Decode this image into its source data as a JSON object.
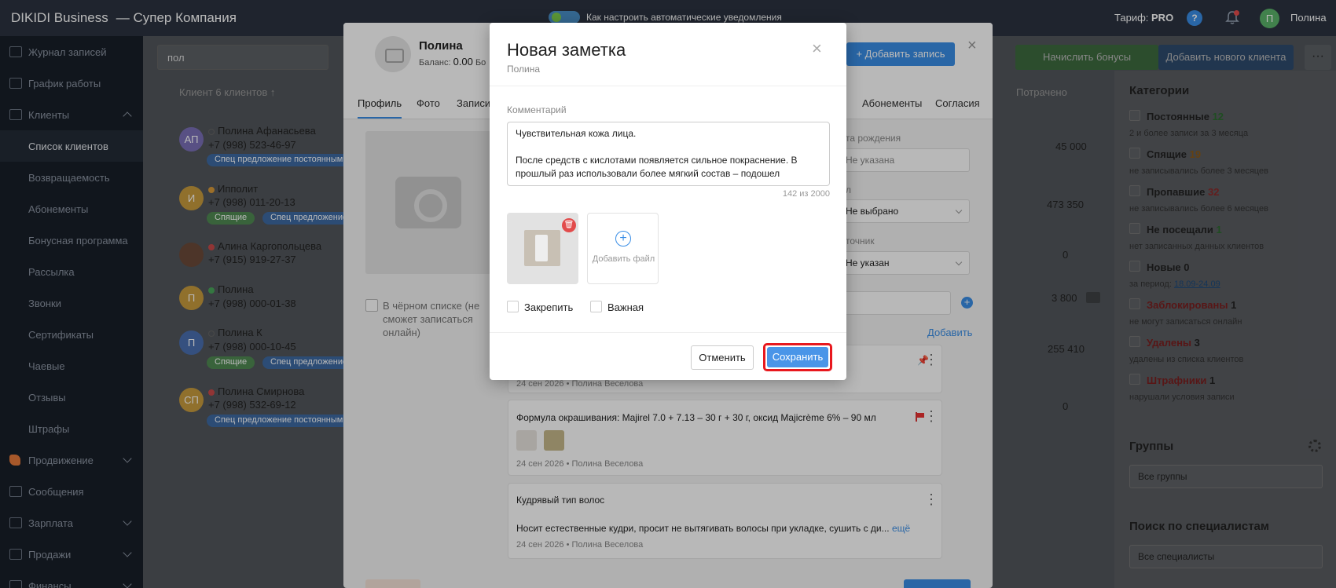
{
  "topbar": {
    "brand": "DIKIDI Business",
    "company": "— Супер Компания",
    "notice": "Как настроить автоматические уведомления",
    "tariff_label": "Тариф:",
    "tariff_value": "PRO",
    "help": "?",
    "user_initial": "П",
    "user_name": "Полина"
  },
  "sidebar": {
    "items": [
      {
        "label": "Журнал записей"
      },
      {
        "label": "График работы"
      },
      {
        "label": "Клиенты"
      },
      {
        "label": "Список клиентов"
      },
      {
        "label": "Возвращаемость"
      },
      {
        "label": "Абонементы"
      },
      {
        "label": "Бонусная программа"
      },
      {
        "label": "Рассылка"
      },
      {
        "label": "Звонки"
      },
      {
        "label": "Сертификаты"
      },
      {
        "label": "Чаевые"
      },
      {
        "label": "Отзывы"
      },
      {
        "label": "Штрафы"
      },
      {
        "label": "Продвижение"
      },
      {
        "label": "Сообщения"
      },
      {
        "label": "Зарплата"
      },
      {
        "label": "Продажи"
      },
      {
        "label": "Финансы"
      }
    ]
  },
  "clients": {
    "search_value": "пол",
    "header": "Клиент 6 клиентов ↑",
    "spent_header": "Потрачено",
    "buttons": {
      "bonus": "Начислить бонусы",
      "add_client": "Добавить нового клиента",
      "more": "···"
    },
    "rows": [
      {
        "initials": "АП",
        "name": "Полина Афанасьева",
        "phone": "+7 (998) 523-46-97",
        "tag1": "Спец предложение постоянным",
        "spent": "45 000"
      },
      {
        "initials": "И",
        "name": "Ипполит",
        "phone": "+7 (998) 011-20-13",
        "tag1": "Спящие",
        "tag2": "Спец предложение",
        "spent": "473 350"
      },
      {
        "initials": "",
        "name": "Алина Каргопольцева",
        "phone": "+7 (915) 919-27-37",
        "spent": "0"
      },
      {
        "initials": "П",
        "name": "Полина",
        "phone": "+7 (998) 000-01-38",
        "spent": "3 800"
      },
      {
        "initials": "П",
        "name": "Полина К",
        "phone": "+7 (998) 000-10-45",
        "tag1": "Спящие",
        "tag2": "Спец предложение",
        "spent": "255 410"
      },
      {
        "initials": "СП",
        "name": "Полина Смирнова",
        "phone": "+7 (998) 532-69-12",
        "tag1": "Спец предложение постоянным",
        "spent": "0"
      }
    ]
  },
  "categories": {
    "title": "Категории",
    "items": [
      {
        "name": "Постоянные",
        "count": "12",
        "desc": "2 и более записи за 3 месяца"
      },
      {
        "name": "Спящие",
        "count": "19",
        "desc": "не записывались более 3 месяцев"
      },
      {
        "name": "Пропавшие",
        "count": "32",
        "desc": "не записывались более 6 месяцев"
      },
      {
        "name": "Не посещали",
        "count": "1",
        "desc": "нет записанных данных клиентов"
      },
      {
        "name": "Новые",
        "count": "0",
        "desc": "за период:",
        "desc_link": "18.09-24.09"
      },
      {
        "name": "Заблокированы",
        "count": "1",
        "desc": "не могут записаться онлайн"
      },
      {
        "name": "Удалены",
        "count": "3",
        "desc": "удалены из списка клиентов"
      },
      {
        "name": "Штрафники",
        "count": "1",
        "desc": "нарушали условия записи"
      }
    ],
    "groups_title": "Группы",
    "groups_value": "Все группы",
    "specialists_title": "Поиск по специалистам",
    "specialists_value": "Все специалисты"
  },
  "client_card": {
    "name": "Полина",
    "balance_label": "Баланс:",
    "balance_value": "0.00",
    "balance_tail": "Бо",
    "add_record": "+ Добавить запись",
    "close": "×",
    "tabs": [
      "Профиль",
      "Фото",
      "Записи",
      "Абонементы",
      "Согласия"
    ],
    "blacklist": "В чёрном списке (не сможет записаться онлайн)",
    "birth_label": "та рождения",
    "birth_value": "Не указана",
    "gender_label": "л",
    "gender_value": "Не выбрано",
    "source_label": "точник",
    "source_value": "Не указан",
    "add_link": "Добавить",
    "notes": [
      {
        "text": "",
        "meta": "24 сен 2026 • Полина Веселова"
      },
      {
        "text": "Формула окрашивания: Majirel 7.0 + 7.13 – 30 г + 30 г, оксид Majicrème 6% – 90 мл",
        "meta": "24 сен 2026 • Полина Веселова"
      },
      {
        "text": "Кудрявый тип волос",
        "body": "Носит естественные кудри, просит не вытягивать волосы при укладке, сушить с ди...",
        "more": "ещё",
        "meta": "24 сен 2026 • Полина Веселова"
      }
    ]
  },
  "modal": {
    "title": "Новая заметка",
    "subtitle": "Полина",
    "close": "×",
    "comment_label": "Комментарий",
    "comment_line1": "Чувствительная кожа лица.",
    "comment_line2": "После средств с кислотами появляется сильное покраснение. В прошлый раз использовали более мягкий состав – подошел",
    "counter": "142 из 2000",
    "add_file": "Добавить файл",
    "pin_label": "Закрепить",
    "important_label": "Важная",
    "cancel": "Отменить",
    "save": "Сохранить"
  }
}
